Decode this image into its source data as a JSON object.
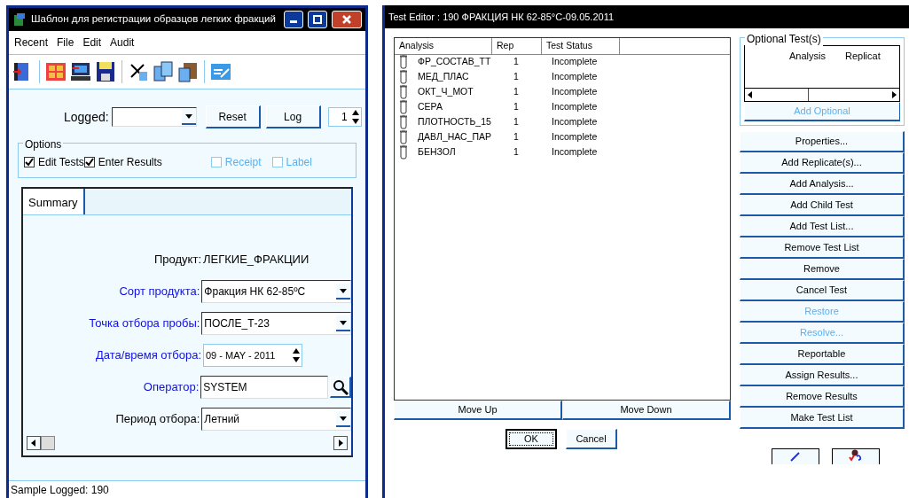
{
  "left_window": {
    "title": "Шаблон для регистрации образцов легких фракций",
    "menu": [
      "Recent",
      "File",
      "Edit",
      "Audit"
    ],
    "logged": {
      "label": "Logged:",
      "buttons": [
        "Reset",
        "Log"
      ],
      "count": "1"
    },
    "options": {
      "title": "Options",
      "checkboxes": [
        {
          "label": "Edit Tests",
          "checked": true,
          "disabled": false
        },
        {
          "label": "Enter Results",
          "checked": true,
          "disabled": false
        },
        {
          "label": "Receipt",
          "checked": false,
          "disabled": true
        },
        {
          "label": "Label",
          "checked": false,
          "disabled": true
        }
      ]
    },
    "tabs": [
      {
        "label": "Summary",
        "selected": true
      }
    ],
    "fields": [
      {
        "kind": "static",
        "label": "Продукт:",
        "value": "ЛЕГКИЕ_ФРАКЦИИ",
        "required": false
      },
      {
        "kind": "combo",
        "label": "Сорт продукта:",
        "value": "Фракция НК 62-85ºC",
        "required": true
      },
      {
        "kind": "combo",
        "label": "Точка отбора пробы:",
        "value": "ПОСЛЕ_Т-23",
        "required": true
      },
      {
        "kind": "date",
        "label": "Дата/время отбора:",
        "value": "09 - MAY - 2011",
        "required": true
      },
      {
        "kind": "lookup",
        "label": "Оператор:",
        "value": "SYSTEM",
        "required": true
      },
      {
        "kind": "combo",
        "label": "Период отбора:",
        "value": "Летний",
        "required": false
      }
    ],
    "status_bar": "Sample Logged: 190"
  },
  "test_editor": {
    "title": "Test Editor : 190   ФРАКЦИЯ НК 62-85°C-09.05.2011",
    "table": {
      "columns": [
        "Analysis",
        "Rep",
        "Test Status"
      ],
      "rows": [
        {
          "analysis": "ФР_СОСТАВ_ТТ",
          "rep": "1",
          "status": "Incomplete"
        },
        {
          "analysis": "МЕД_ПЛАС",
          "rep": "1",
          "status": "Incomplete"
        },
        {
          "analysis": "ОКТ_Ч_МОТ",
          "rep": "1",
          "status": "Incomplete"
        },
        {
          "analysis": "СЕРА",
          "rep": "1",
          "status": "Incomplete"
        },
        {
          "analysis": "ПЛОТНОСТЬ_15",
          "rep": "1",
          "status": "Incomplete"
        },
        {
          "analysis": "ДАВЛ_НАС_ПАР",
          "rep": "1",
          "status": "Incomplete"
        },
        {
          "analysis": "БЕНЗОЛ",
          "rep": "1",
          "status": "Incomplete"
        }
      ]
    },
    "move_buttons": [
      "Move Up",
      "Move Down"
    ],
    "dialog_buttons": [
      "OK",
      "Cancel"
    ],
    "optional": {
      "title": "Optional Test(s)",
      "columns": [
        "Analysis",
        "Replicat"
      ],
      "button": {
        "label": "Add Optional",
        "disabled": true
      }
    },
    "actions": [
      {
        "label": "Properties...",
        "disabled": false
      },
      {
        "label": "Add Replicate(s)...",
        "disabled": false
      },
      {
        "label": "Add Analysis...",
        "disabled": false
      },
      {
        "label": "Add Child Test",
        "disabled": false
      },
      {
        "label": "Add Test List...",
        "disabled": false
      },
      {
        "label": "Remove Test List",
        "disabled": false
      },
      {
        "label": "Remove",
        "disabled": false
      },
      {
        "label": "Cancel Test",
        "disabled": false
      },
      {
        "label": "Restore",
        "disabled": true
      },
      {
        "label": "Resolve...",
        "disabled": true
      },
      {
        "label": "Reportable",
        "disabled": false
      },
      {
        "label": "Assign Results...",
        "disabled": false
      },
      {
        "label": "Remove Results",
        "disabled": false
      },
      {
        "label": "Make Test List",
        "disabled": false
      }
    ]
  }
}
